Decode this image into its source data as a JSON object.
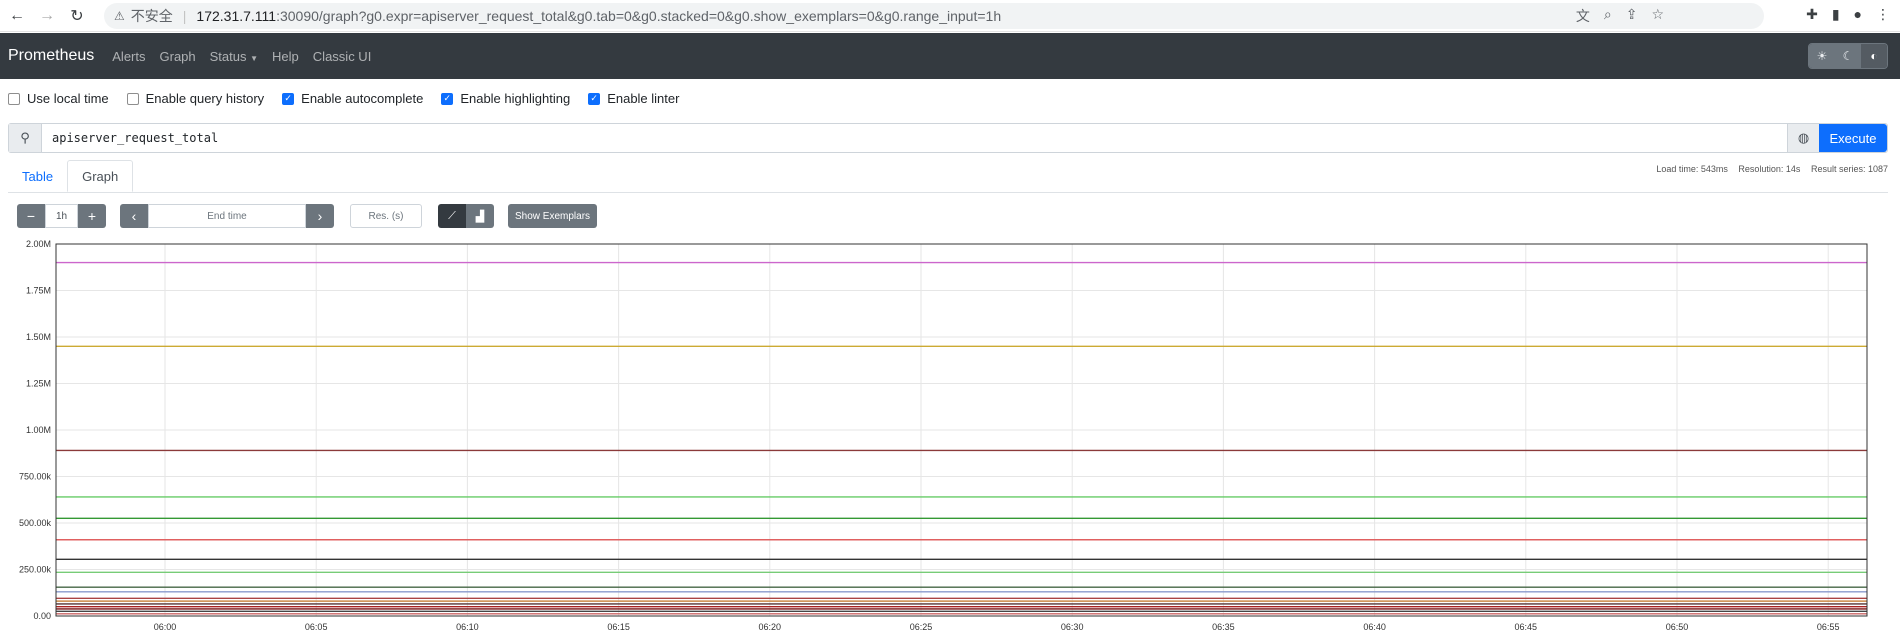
{
  "browser": {
    "back_icon": "arrow-left-icon",
    "forward_icon": "arrow-right-icon",
    "reload_icon": "reload-icon",
    "security_text": "不安全",
    "url_host": "172.31.7.111",
    "url_rest": ":30090/graph?g0.expr=apiserver_request_total&g0.tab=0&g0.stacked=0&g0.show_exemplars=0&g0.range_input=1h"
  },
  "navbar": {
    "brand": "Prometheus",
    "links": [
      "Alerts",
      "Graph",
      "Status",
      "Help",
      "Classic UI"
    ]
  },
  "options": [
    {
      "label": "Use local time",
      "checked": false
    },
    {
      "label": "Enable query history",
      "checked": false
    },
    {
      "label": "Enable autocomplete",
      "checked": true
    },
    {
      "label": "Enable highlighting",
      "checked": true
    },
    {
      "label": "Enable linter",
      "checked": true
    }
  ],
  "expression": {
    "query": "apiserver_request_total",
    "execute_label": "Execute"
  },
  "stats": {
    "load_time": "Load time: 543ms",
    "resolution": "Resolution: 14s",
    "result_series": "Result series: 1087"
  },
  "tabs": {
    "table": "Table",
    "graph": "Graph",
    "active": "Graph"
  },
  "controls": {
    "range": "1h",
    "end_time_placeholder": "End time",
    "resolution_placeholder": "Res. (s)",
    "show_exemplars": "Show Exemplars"
  },
  "chart_data": {
    "type": "line",
    "title": "",
    "xlabel": "",
    "ylabel": "",
    "ylim": [
      0,
      2000000
    ],
    "y_ticks": [
      "0.00",
      "250.00k",
      "500.00k",
      "750.00k",
      "1.00M",
      "1.25M",
      "1.50M",
      "1.75M",
      "2.00M"
    ],
    "x_ticks": [
      "06:00",
      "06:05",
      "06:10",
      "06:15",
      "06:20",
      "06:25",
      "06:30",
      "06:35",
      "06:40",
      "06:45",
      "06:50",
      "06:55"
    ],
    "grid": true,
    "series": [
      {
        "color": "#cc66cc",
        "values": [
          1900000,
          1900000
        ]
      },
      {
        "color": "#ccaa33",
        "values": [
          1450000,
          1450000
        ]
      },
      {
        "color": "#8b3a3a",
        "values": [
          890000,
          890000
        ]
      },
      {
        "color": "#66cc66",
        "values": [
          640000,
          640000
        ]
      },
      {
        "color": "#339933",
        "values": [
          525000,
          525000
        ]
      },
      {
        "color": "#e06060",
        "values": [
          410000,
          410000
        ]
      },
      {
        "color": "#333333",
        "values": [
          305000,
          305000
        ]
      },
      {
        "color": "#77cc77",
        "values": [
          235000,
          235000
        ]
      },
      {
        "color": "#446644",
        "values": [
          155000,
          155000
        ]
      },
      {
        "color": "#8899cc",
        "values": [
          130000,
          130000
        ]
      },
      {
        "color": "#aa4444",
        "values": [
          95000,
          95000
        ]
      },
      {
        "color": "#cc8844",
        "values": [
          80000,
          80000
        ]
      },
      {
        "color": "#553333",
        "values": [
          65000,
          65000
        ]
      },
      {
        "color": "#aa2222",
        "values": [
          50000,
          50000
        ]
      },
      {
        "color": "#771111",
        "values": [
          38000,
          38000
        ]
      },
      {
        "color": "#444444",
        "values": [
          25000,
          25000
        ]
      },
      {
        "color": "#cc6666",
        "values": [
          12000,
          12000
        ]
      }
    ]
  }
}
